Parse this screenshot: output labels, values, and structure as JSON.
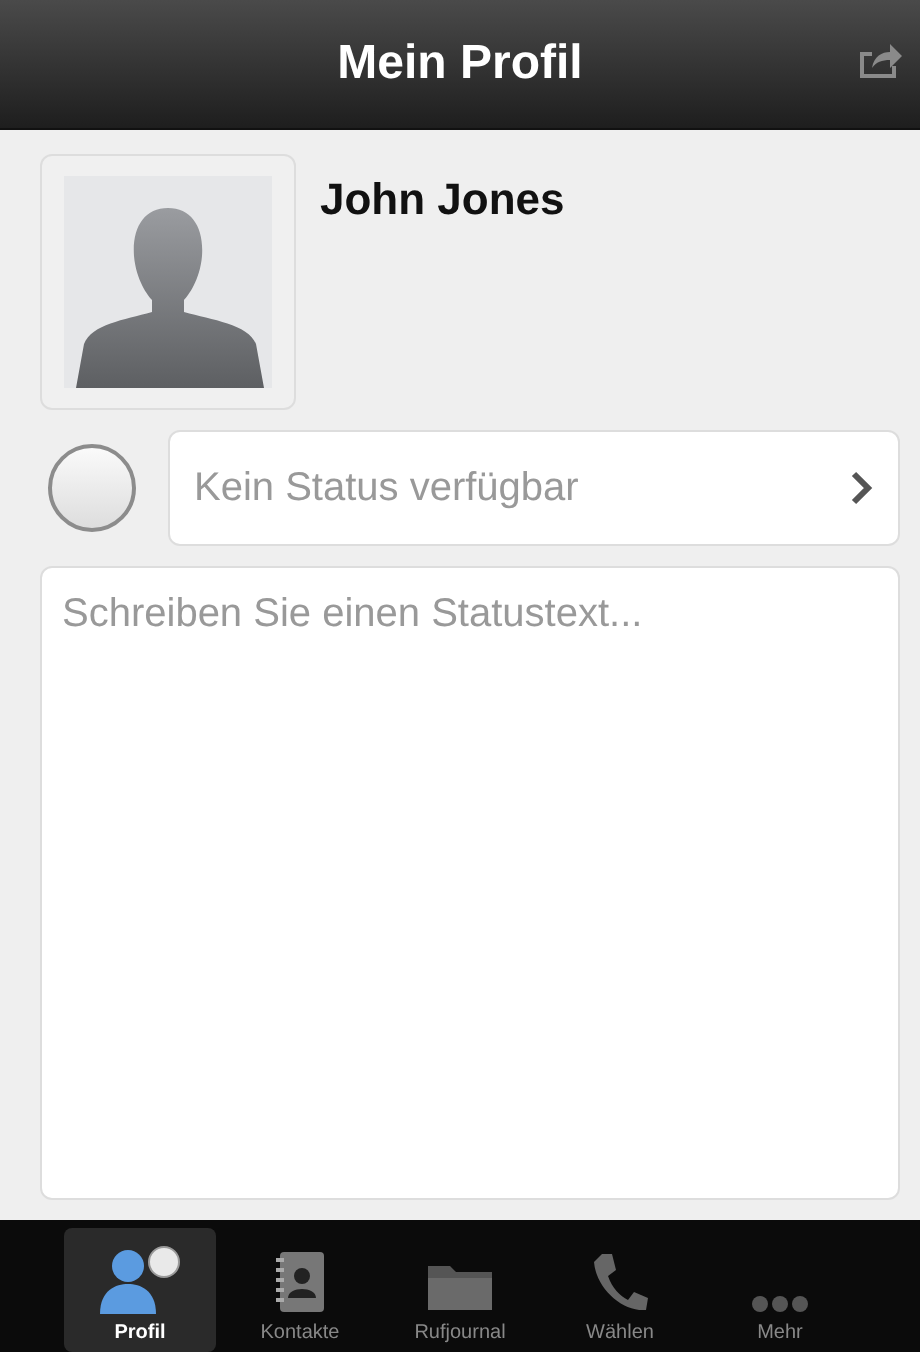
{
  "header": {
    "title": "Mein Profil"
  },
  "profile": {
    "name": "John Jones"
  },
  "status": {
    "value": "Kein Status verfügbar"
  },
  "status_text": {
    "placeholder": "Schreiben Sie einen Statustext..."
  },
  "tabs": [
    {
      "label": "Profil",
      "kind": "profile",
      "selected": true
    },
    {
      "label": "Kontakte",
      "kind": "contacts",
      "selected": false
    },
    {
      "label": "Rufjournal",
      "kind": "folder",
      "selected": false
    },
    {
      "label": "Wählen",
      "kind": "phone",
      "selected": false
    },
    {
      "label": "Mehr",
      "kind": "more",
      "selected": false
    }
  ]
}
